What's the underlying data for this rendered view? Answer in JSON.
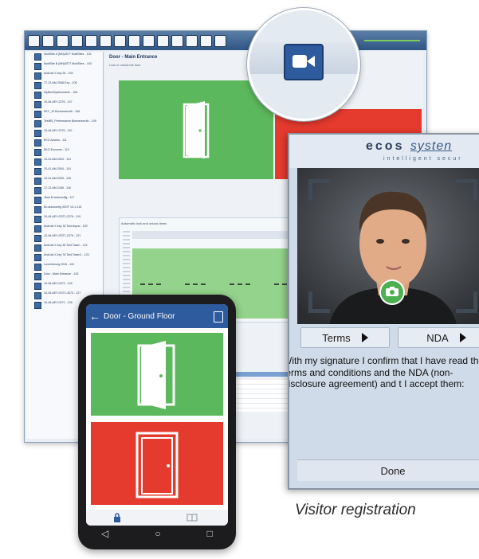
{
  "desktop": {
    "door_title": "Door - Main Entrance",
    "door_subtitle": "Lock or unlock the door",
    "chart_header": "Automatic lock and unlock times",
    "tree_items": [
      "MultiSite A (MN)4577 MultiSites - 102",
      "MultiSite B (MN)4577 MultiSites - 103",
      "Android X key 26 - 104",
      "17-12-AM-2548-Key - 105",
      "MyNewSystemname - 106",
      "10-46-AEY-2276 - 107",
      "KEY_10 Bonnerseruth - 108",
      "TestBS_Performance Bonnerseruth - 109",
      "10-46-AEY-2276 - 110",
      "EKO Access - 111",
      "EKO Econorm - 112",
      "10-41-AM-2004 - 113",
      "10-41-AM-2004 - 114",
      "10-41-AM-2005 - 115",
      "17-12-AM-2446 - 116",
      "Jean M autoconfig - 117",
      "Bo autoconfig 40GF 10-1-115",
      "10-46-AEY-OST1-2276 - 119",
      "Android X key 78 Test Async - 120",
      "10-46-AEY-OST1-2276 - 121",
      "Android X key 35 Test Token - 122",
      "Android X key 78 Test Token2 - 123",
      "Luxembourg 2016 - 124",
      "Door - Main Entrance - 125",
      "10-45-AEY-0073 - 126",
      "10-45-AEY-OST1-3073 - 127",
      "10-45-AEY-0271 - 128"
    ]
  },
  "visitor": {
    "brand_main": "ecos",
    "brand_suffix": "systen",
    "tagline": "intelligent secur",
    "terms_label": "Terms",
    "nda_label": "NDA",
    "consent_text": "With my signature I confirm that I have read the terms and conditions and the NDA (non-disclosure agreement) and t I accept them:",
    "done_label": "Done"
  },
  "phone": {
    "title": "Door - Ground Floor",
    "back_glyph": "←"
  },
  "caption": "Visitor registration",
  "colors": {
    "open_green": "#5cb85c",
    "locked_red": "#e53a2e",
    "brand_blue": "#2e5a9e",
    "camera_green": "#4caf50"
  },
  "icons": [
    "video-camera-icon",
    "camera-icon",
    "door-open-icon",
    "door-closed-icon",
    "lock-icon",
    "book-icon",
    "back-arrow-icon",
    "edit-icon"
  ]
}
